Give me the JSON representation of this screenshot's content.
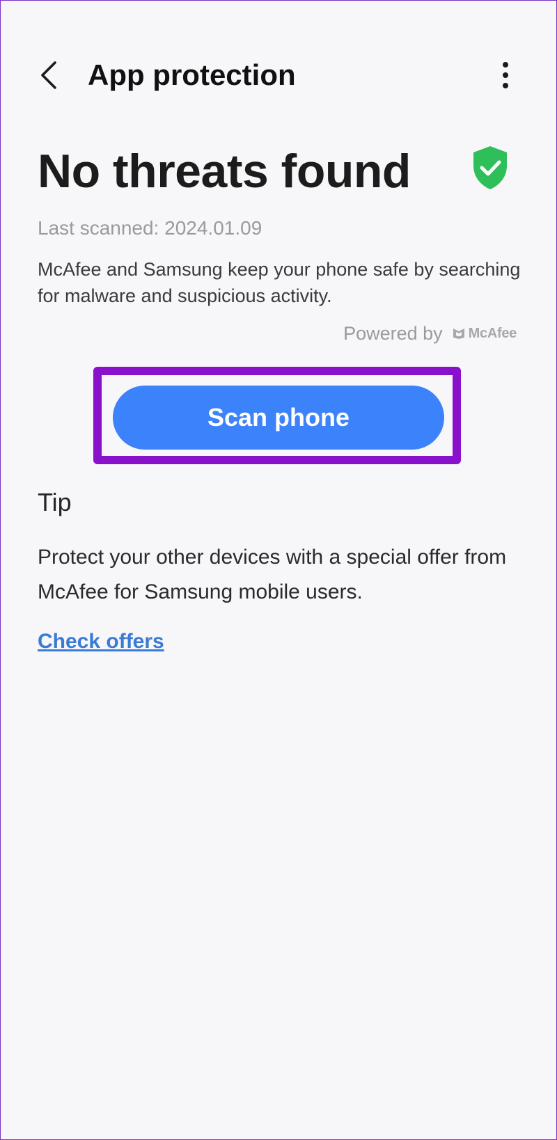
{
  "header": {
    "title": "App protection",
    "back_icon": "chevron-left-icon",
    "more_icon": "more-vertical-icon"
  },
  "status": {
    "title": "No threats found",
    "icon": "shield-check-icon",
    "icon_color": "#2fbf5a",
    "last_scanned": "Last scanned: 2024.01.09",
    "description": "McAfee and Samsung keep your phone safe by searching for malware and suspicious activity.",
    "powered_by": "Powered by",
    "brand": "McAfee"
  },
  "scan_button": {
    "label": "Scan phone",
    "color": "#3b82fb",
    "highlight_color": "#8a11cc"
  },
  "tip": {
    "heading": "Tip",
    "body": "Protect your other devices with a special offer from McAfee for Samsung mobile users.",
    "link_label": "Check offers",
    "link_color": "#3a7bd5"
  }
}
